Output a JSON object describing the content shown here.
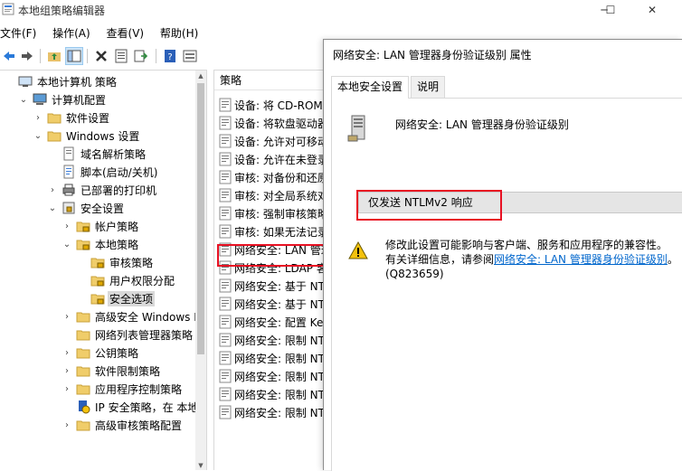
{
  "window": {
    "title": "本地组策略编辑器",
    "minimize": "─",
    "maximize": "☐",
    "close": "✕"
  },
  "menu": [
    "文件(F)",
    "操作(A)",
    "查看(V)",
    "帮助(H)"
  ],
  "tree": {
    "items": [
      {
        "label": "本地计算机 策略",
        "icon": "computer-policy-icon",
        "chevron": ""
      },
      {
        "label": "计算机配置",
        "icon": "computer-icon",
        "chevron": "⌄"
      },
      {
        "label": "软件设置",
        "icon": "folder-icon",
        "chevron": "›"
      },
      {
        "label": "Windows 设置",
        "icon": "folder-icon",
        "chevron": "⌄"
      },
      {
        "label": "域名解析策略",
        "icon": "policy-icon",
        "chevron": ""
      },
      {
        "label": "脚本(启动/关机)",
        "icon": "script-icon",
        "chevron": ""
      },
      {
        "label": "已部署的打印机",
        "icon": "printer-icon",
        "chevron": "›"
      },
      {
        "label": "安全设置",
        "icon": "security-icon",
        "chevron": "⌄"
      },
      {
        "label": "帐户策略",
        "icon": "folder-lock-icon",
        "chevron": "›"
      },
      {
        "label": "本地策略",
        "icon": "folder-lock-icon",
        "chevron": "⌄"
      },
      {
        "label": "审核策略",
        "icon": "folder-lock-icon",
        "chevron": ""
      },
      {
        "label": "用户权限分配",
        "icon": "folder-lock-icon",
        "chevron": ""
      },
      {
        "label": "安全选项",
        "icon": "folder-lock-icon",
        "chevron": ""
      },
      {
        "label": "高级安全 Windows De",
        "icon": "folder-icon",
        "chevron": "›"
      },
      {
        "label": "网络列表管理器策略",
        "icon": "folder-icon",
        "chevron": ""
      },
      {
        "label": "公钥策略",
        "icon": "folder-icon",
        "chevron": "›"
      },
      {
        "label": "软件限制策略",
        "icon": "folder-icon",
        "chevron": "›"
      },
      {
        "label": "应用程序控制策略",
        "icon": "folder-icon",
        "chevron": "›"
      },
      {
        "label": "IP 安全策略，在 本地计",
        "icon": "ip-security-icon",
        "chevron": ""
      },
      {
        "label": "高级审核策略配置",
        "icon": "folder-icon",
        "chevron": "›"
      }
    ]
  },
  "list": {
    "header": "策略",
    "items": [
      "设备: 将 CD-ROM",
      "设备: 将软盘驱动器",
      "设备: 允许对可移动",
      "设备: 允许在未登录",
      "审核: 对备份和还原",
      "审核: 对全局系统对",
      "审核: 强制审核策略",
      "审核: 如果无法记录",
      "网络安全: LAN 管理",
      "网络安全: LDAP 客",
      "网络安全: 基于 NT",
      "网络安全: 基于 NT",
      "网络安全: 配置 Ke",
      "网络安全: 限制 NT",
      "网络安全: 限制 NT",
      "网络安全: 限制 NT",
      "网络安全: 限制 NT",
      "网络安全: 限制 NT"
    ]
  },
  "dialog": {
    "title": "网络安全: LAN 管理器身份验证级别 属性",
    "tabs": [
      "本地安全设置",
      "说明"
    ],
    "policy_name": "网络安全: LAN 管理器身份验证级别",
    "selected_value": "仅发送 NTLMv2 响应",
    "warning_text_1": "修改此设置可能影响与客户端、服务和应用程序的兼容性。",
    "warning_text_2": "有关详细信息，请参阅",
    "warning_link": "网络安全: LAN 管理器身份验证级别",
    "warning_text_3": "。",
    "warning_ref": "(Q823659)"
  },
  "colors": {
    "highlight": "#e81123",
    "link": "#0066cc",
    "selection": "#d9d9d9"
  }
}
